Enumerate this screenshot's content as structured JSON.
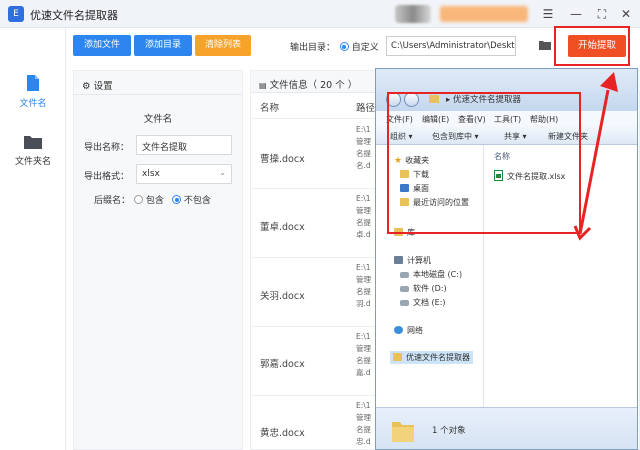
{
  "app": {
    "title": "优速文件名提取器",
    "icon_glyph": "E"
  },
  "window_controls": {
    "menu": "☰",
    "minimize": "—",
    "maximize": "⛶",
    "close": "✕"
  },
  "nav": [
    {
      "label": "文件名",
      "icon": "document-icon",
      "active": true
    },
    {
      "label": "文件夹名",
      "icon": "folder-icon",
      "active": false
    }
  ],
  "toolbar": {
    "add_file": "添加文件",
    "add_dir": "添加目录",
    "clear_list": "清除列表",
    "output_dir_label": "输出目录：",
    "custom_label": "自定义",
    "output_path": "C:\\Users\\Administrator\\Deskto",
    "start": "开始提取"
  },
  "settings": {
    "header": "设置",
    "section_title": "文件名",
    "export_name_label": "导出名称：",
    "export_name_value": "文件名提取",
    "export_format_label": "导出格式：",
    "export_format_value": "xlsx",
    "suffix_label": "后缀名：",
    "include": "包含",
    "exclude": "不包含"
  },
  "filelist": {
    "header": "文件信息（ 20 个 ）",
    "col_name": "名称",
    "col_path": "路径",
    "rows": [
      {
        "name": "曹操.docx",
        "path": [
          "E:\\1",
          "管理",
          "名提",
          "名.d"
        ]
      },
      {
        "name": "董卓.docx",
        "path": [
          "E:\\1",
          "管理",
          "名提",
          "卓.d"
        ]
      },
      {
        "name": "关羽.docx",
        "path": [
          "E:\\1",
          "管理",
          "名提",
          "羽.d"
        ]
      },
      {
        "name": "郭嘉.docx",
        "path": [
          "E:\\1",
          "管理",
          "名提",
          "嘉.d"
        ]
      },
      {
        "name": "黄忠.docx",
        "path": [
          "E:\\1",
          "管理",
          "名提",
          "忠.d"
        ]
      }
    ]
  },
  "explorer": {
    "breadcrumb": "优速文件名提取器",
    "menu": [
      "文件(F)",
      "编辑(E)",
      "查看(V)",
      "工具(T)",
      "帮助(H)"
    ],
    "tools": [
      "组织 ▾",
      "包含到库中 ▾",
      "共享 ▾",
      "新建文件夹"
    ],
    "favorites": "收藏夹",
    "downloads": "下载",
    "desktop": "桌面",
    "recent": "最近访问的位置",
    "library": "库",
    "computer": "计算机",
    "drive_c": "本地磁盘 (C:)",
    "drive_d": "软件 (D:)",
    "drive_e": "文档 (E:)",
    "network": "网络",
    "current_folder": "优速文件名提取器",
    "col_name": "名称",
    "file": "文件名提取.xlsx",
    "status": "1 个对象"
  },
  "colors": {
    "accent_blue": "#2d86f0",
    "accent_orange": "#f7a22b",
    "start_red": "#f04f23",
    "annotation_red": "#e82323"
  }
}
